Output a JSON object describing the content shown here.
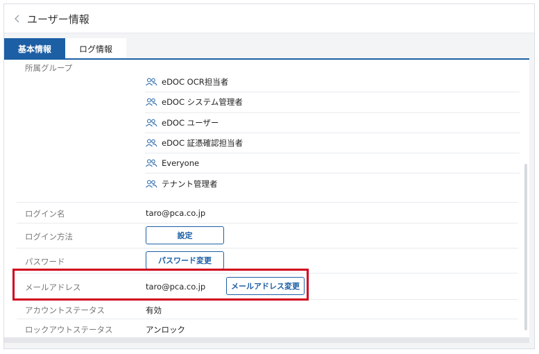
{
  "header": {
    "title": "ユーザー情報",
    "back_icon": "chevron-left-icon"
  },
  "tabs": [
    {
      "label": "基本情報",
      "active": true
    },
    {
      "label": "ログ情報",
      "active": false
    }
  ],
  "groups": {
    "label": "所属グループ",
    "icon": "people-icon",
    "items": [
      "eDOC OCR担当者",
      "eDOC システム管理者",
      "eDOC ユーザー",
      "eDOC 証憑確認担当者",
      "Everyone",
      "テナント管理者"
    ]
  },
  "fields": {
    "login_name": {
      "label": "ログイン名",
      "value": "taro@pca.co.jp"
    },
    "login_method": {
      "label": "ログイン方法",
      "button": "設定"
    },
    "password": {
      "label": "パスワード",
      "button": "パスワード変更"
    },
    "email": {
      "label": "メールアドレス",
      "value": "taro@pca.co.jp",
      "button": "メールアドレス変更"
    },
    "account_status": {
      "label": "アカウントステータス",
      "value": "有効"
    },
    "lockout_status": {
      "label": "ロックアウトステータス",
      "value": "アンロック"
    }
  },
  "colors": {
    "accent": "#1c5fa5",
    "highlight": "#d0021b"
  }
}
